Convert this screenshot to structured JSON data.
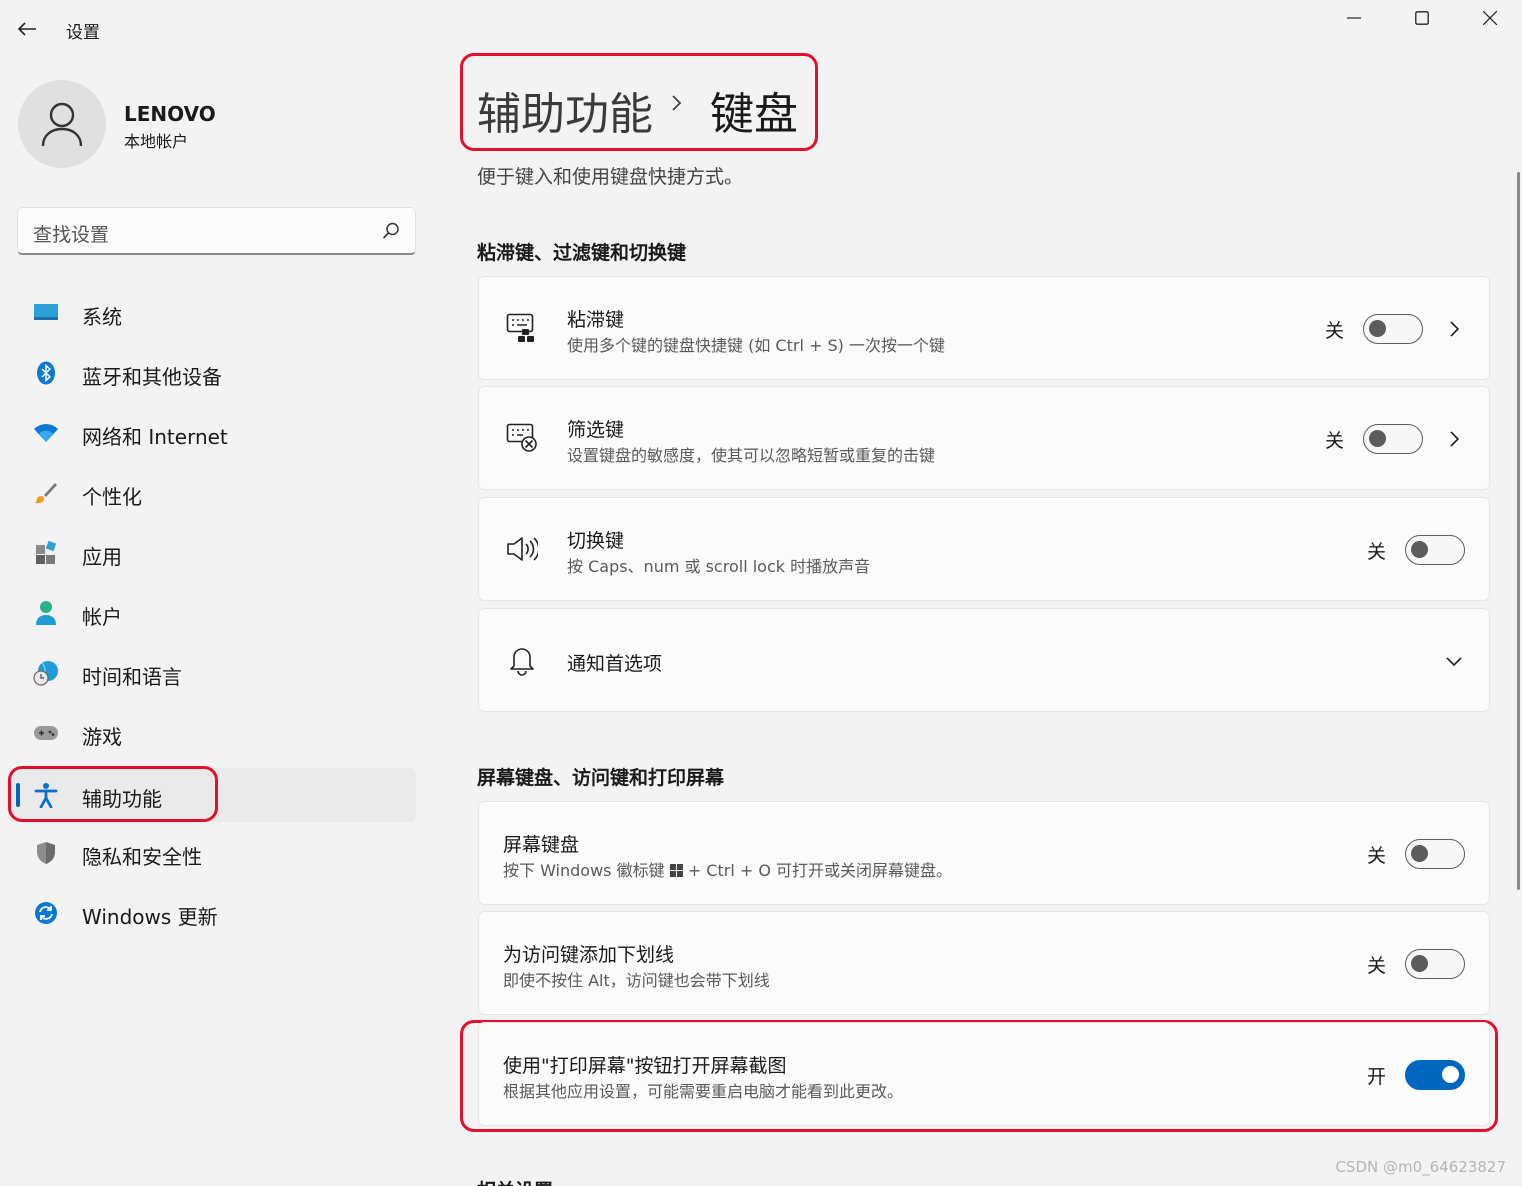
{
  "app": {
    "title": "设置"
  },
  "user": {
    "name": "LENOVO",
    "account_type": "本地帐户"
  },
  "search": {
    "placeholder": "查找设置"
  },
  "nav": {
    "items": [
      {
        "label": "系统",
        "icon": "system-icon"
      },
      {
        "label": "蓝牙和其他设备",
        "icon": "bluetooth-icon"
      },
      {
        "label": "网络和 Internet",
        "icon": "wifi-icon"
      },
      {
        "label": "个性化",
        "icon": "brush-icon"
      },
      {
        "label": "应用",
        "icon": "apps-icon"
      },
      {
        "label": "帐户",
        "icon": "account-icon"
      },
      {
        "label": "时间和语言",
        "icon": "time-language-icon"
      },
      {
        "label": "游戏",
        "icon": "gamepad-icon"
      },
      {
        "label": "辅助功能",
        "icon": "accessibility-icon",
        "active": true
      },
      {
        "label": "隐私和安全性",
        "icon": "shield-icon"
      },
      {
        "label": "Windows 更新",
        "icon": "update-icon"
      }
    ]
  },
  "breadcrumb": {
    "parent": "辅助功能",
    "current": "键盘"
  },
  "page": {
    "description": "便于键入和使用键盘快捷方式。"
  },
  "sections": [
    {
      "title": "粘滞键、过滤键和切换键",
      "cards": [
        {
          "title": "粘滞键",
          "description": "使用多个键的键盘快捷键 (如 Ctrl + S) 一次按一个键",
          "state": "关",
          "on": false,
          "icon": "sticky-keys-icon"
        },
        {
          "title": "筛选键",
          "description": "设置键盘的敏感度，使其可以忽略短暂或重复的击键",
          "state": "关",
          "on": false,
          "icon": "filter-keys-icon"
        },
        {
          "title": "切换键",
          "description": "按 Caps、num 或 scroll lock 时播放声音",
          "state": "关",
          "on": false,
          "icon": "speaker-icon"
        },
        {
          "title": "通知首选项",
          "icon": "bell-icon"
        }
      ]
    },
    {
      "title": "屏幕键盘、访问键和打印屏幕",
      "cards": [
        {
          "title": "屏幕键盘",
          "description_before": "按下 Windows 徽标键",
          "description_after": "+ Ctrl + O 可打开或关闭屏幕键盘。",
          "state": "关",
          "on": false
        },
        {
          "title": "为访问键添加下划线",
          "description": "即使不按住 Alt，访问键也会带下划线",
          "state": "关",
          "on": false
        },
        {
          "title": "使用\"打印屏幕\"按钮打开屏幕截图",
          "description": "根据其他应用设置，可能需要重启电脑才能看到此更改。",
          "state": "开",
          "on": true
        }
      ]
    },
    {
      "title": "相关设置"
    }
  ],
  "watermark": "CSDN @m0_64623827",
  "colors": {
    "accent": "#0067c0",
    "highlight_box": "#e0102e",
    "background": "#f3f3f3",
    "card": "#fbfbfb"
  }
}
